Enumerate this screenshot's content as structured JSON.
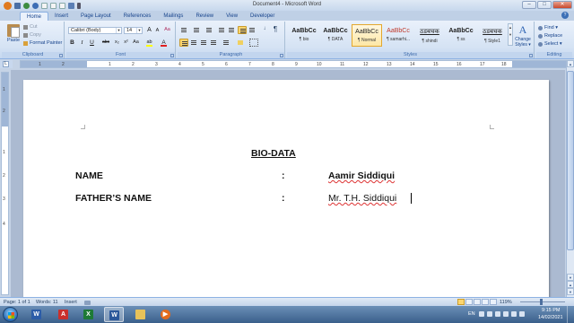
{
  "window": {
    "title": "Document4 - Microsoft Word",
    "minimize": "–",
    "maximize": "□",
    "close": "✕"
  },
  "tabs": [
    {
      "label": "Home",
      "active": true
    },
    {
      "label": "Insert"
    },
    {
      "label": "Page Layout"
    },
    {
      "label": "References"
    },
    {
      "label": "Mailings"
    },
    {
      "label": "Review"
    },
    {
      "label": "View"
    },
    {
      "label": "Developer"
    }
  ],
  "ribbon": {
    "clipboard": {
      "paste": "Paste",
      "cut": "Cut",
      "copy": "Copy",
      "format_painter": "Format Painter",
      "label": "Clipboard"
    },
    "font": {
      "name": "Calibri (Body)",
      "size": "14",
      "grow": "A",
      "shrink": "A",
      "clear": "Aa",
      "bold": "B",
      "italic": "I",
      "underline": "U",
      "strike": "abc",
      "subscript": "x₂",
      "superscript": "x²",
      "case": "Aa",
      "highlight": "ab",
      "color": "A",
      "label": "Font"
    },
    "paragraph": {
      "pilcrow": "¶",
      "label": "Paragraph"
    },
    "styles": {
      "items": [
        {
          "sample": "AaBbCc",
          "name": "¶ bio"
        },
        {
          "sample": "AaBbCc",
          "name": "¶ DATA"
        },
        {
          "sample": "AaBbCc",
          "name": "¶ Normal"
        },
        {
          "sample": "AaBbCc",
          "name": "¶ samarhi..."
        },
        {
          "sample": "ठडबचक",
          "name": "¶ shindi"
        },
        {
          "sample": "AaBbCc",
          "name": "¶ ss"
        },
        {
          "sample": "ठडबचक",
          "name": "¶ Style1"
        }
      ],
      "change_styles_line1": "Change",
      "change_styles_line2": "Styles ▾",
      "label": "Styles"
    },
    "editing": {
      "find": "Find ▾",
      "replace": "Replace",
      "select": "Select ▾",
      "label": "Editing"
    }
  },
  "ruler": {
    "h_numbers": [
      "1",
      "2",
      "1",
      "2",
      "3",
      "4",
      "5",
      "6",
      "7",
      "8",
      "9",
      "10",
      "11",
      "12",
      "13",
      "14",
      "15",
      "16",
      "17",
      "18"
    ],
    "v_numbers": [
      "1",
      "2",
      "1",
      "2",
      "3",
      "4"
    ]
  },
  "document": {
    "title": "BIO-DATA",
    "rows": [
      {
        "label": "NAME",
        "colon": ":",
        "value": "Aamir Siddiqui"
      },
      {
        "label": "FATHER’S NAME",
        "colon": ":",
        "value": "Mr. T.H. Siddiqui"
      }
    ]
  },
  "status": {
    "page": "Page: 1 of 1",
    "words": "Words: 11",
    "mode": "Insert",
    "zoom": "119%"
  },
  "taskbar": {
    "apps": [
      {
        "name": "word-2003",
        "glyph": "W",
        "color": "#2c5ca8"
      },
      {
        "name": "acrobat",
        "glyph": "A",
        "color": "#c9302c"
      },
      {
        "name": "excel",
        "glyph": "X",
        "color": "#1e7a36"
      },
      {
        "name": "word",
        "glyph": "W",
        "color": "#2b579a",
        "active": true
      },
      {
        "name": "folder",
        "glyph": "",
        "color": "#e8c25a"
      },
      {
        "name": "media",
        "glyph": "▶",
        "color": "#e26b1c"
      }
    ],
    "lang": "EN",
    "time": "9:15 PM",
    "date": "14/02/2021"
  }
}
